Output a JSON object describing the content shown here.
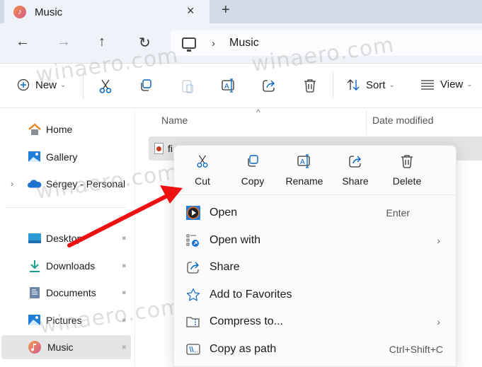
{
  "window": {
    "tab_title": "Music",
    "tab_close": "×",
    "new_tab": "+"
  },
  "nav": {
    "back": "←",
    "forward": "→",
    "up": "↑",
    "refresh": "↻",
    "breadcrumb_separator": "›",
    "breadcrumb": [
      "Music"
    ]
  },
  "commandbar": {
    "new_label": "New",
    "sort_label": "Sort",
    "view_label": "View",
    "chevron": "⌄"
  },
  "sidebar": {
    "items": [
      {
        "label": "Home",
        "icon": "home-icon"
      },
      {
        "label": "Gallery",
        "icon": "gallery-icon"
      },
      {
        "label": "Sergey - Personal",
        "icon": "onedrive-icon",
        "expandable": true
      },
      {
        "label": "Desktop",
        "icon": "desktop-icon",
        "pinned": true
      },
      {
        "label": "Downloads",
        "icon": "downloads-icon",
        "pinned": true
      },
      {
        "label": "Documents",
        "icon": "documents-icon",
        "pinned": true
      },
      {
        "label": "Pictures",
        "icon": "pictures-icon",
        "pinned": true
      },
      {
        "label": "Music",
        "icon": "music-icon",
        "pinned": true,
        "selected": true
      }
    ],
    "expand_glyph": "›",
    "pin_glyph": "📌"
  },
  "filelist": {
    "columns": [
      "Name",
      "Date modified"
    ],
    "sort_glyph": "^",
    "rows": [
      {
        "name": "fi"
      }
    ]
  },
  "context_menu": {
    "quick_actions": [
      {
        "label": "Cut",
        "icon": "cut-icon"
      },
      {
        "label": "Copy",
        "icon": "copy-icon"
      },
      {
        "label": "Rename",
        "icon": "rename-icon"
      },
      {
        "label": "Share",
        "icon": "share-icon"
      },
      {
        "label": "Delete",
        "icon": "delete-icon"
      }
    ],
    "items": [
      {
        "label": "Open",
        "shortcut": "Enter",
        "icon": "media-player-icon"
      },
      {
        "label": "Open with",
        "submenu": "›",
        "icon": "open-with-icon"
      },
      {
        "label": "Share",
        "icon": "share-icon"
      },
      {
        "label": "Add to Favorites",
        "icon": "star-icon"
      },
      {
        "label": "Compress to...",
        "submenu": "›",
        "icon": "compress-icon"
      },
      {
        "label": "Copy as path",
        "shortcut": "Ctrl+Shift+C",
        "icon": "copy-path-icon"
      }
    ]
  },
  "watermark": "winaero.com",
  "colors": {
    "accent": "#0067c0",
    "annotation_arrow": "#ee1111",
    "tabstrip": "#d0dbe7",
    "navbar": "#eef3f9"
  }
}
